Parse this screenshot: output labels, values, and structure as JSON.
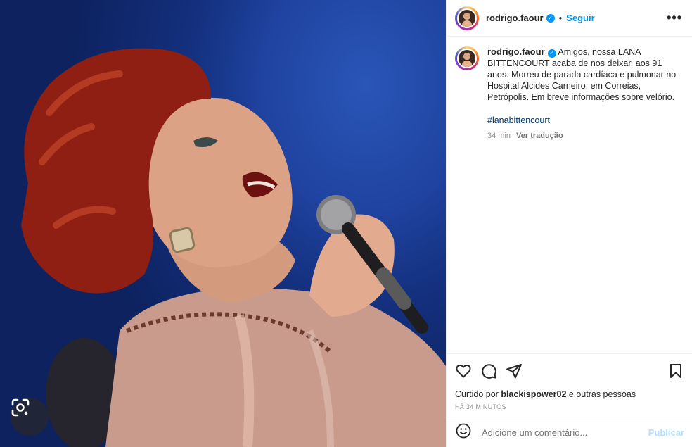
{
  "post": {
    "username": "rodrigo.faour",
    "separator": "•",
    "follow_label": "Seguir",
    "more_label": "•••",
    "verified_mark": "✓"
  },
  "caption": {
    "username": "rodrigo.faour",
    "text": "Amigos, nossa LANA BITTENCOURT acaba de nos deixar, aos 91 anos. Morreu de parada cardíaca e pulmonar no Hospital Alcides Carneiro, em Correias, Petrópolis. Em breve informações sobre velório.",
    "hashtag": "#lanabittencourt",
    "age": "34 min",
    "translate_label": "Ver tradução"
  },
  "actions": {
    "icons": [
      "heart-icon",
      "comment-icon",
      "share-icon",
      "bookmark-icon"
    ]
  },
  "likes": {
    "prefix": "Curtido por",
    "user": "blackispower02",
    "suffix": "e outras pessoas"
  },
  "timestamp": "HÁ 34 MINUTOS",
  "comment_box": {
    "placeholder": "Adicione um comentário...",
    "publish_label": "Publicar"
  },
  "photo": {
    "icon": "google-lens-icon"
  },
  "colors": {
    "accent": "#0095f6",
    "publish_disabled": "#b2dffc",
    "hashtag": "#00376b"
  }
}
